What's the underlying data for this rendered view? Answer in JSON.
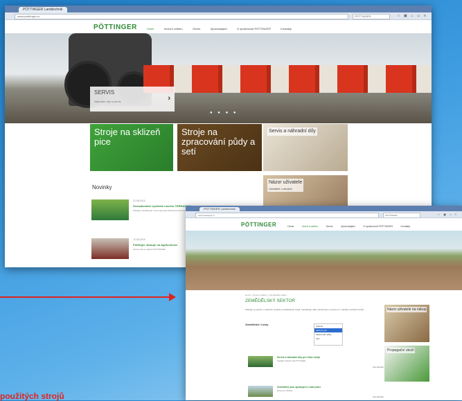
{
  "browser1": {
    "tab_title": "PÖTTINGER Landtechnik",
    "url": "www.poettinger.cz",
    "search": "PÖTTINGER"
  },
  "browser2": {
    "tab_title": "PÖTTINGER Landtechnik",
    "url": "www.poettinger.cz",
    "search": "PÖTTINGER"
  },
  "site": {
    "logo": "PÖTTINGER",
    "nav": [
      "Home",
      "Ihned k odběru",
      "Servis",
      "Zpravodajství",
      "O spolecnosti PÖTTINGER",
      "Kontakty"
    ]
  },
  "hero": {
    "title": "SERVIS",
    "subtitle": "Náhradní díly a servis"
  },
  "tiles": [
    {
      "label": "Stroje na sklizeň pice"
    },
    {
      "label": "Stroje na zpracování půdy a setí"
    },
    {
      "label": "Servis a náhradní díly"
    },
    {
      "label": "Názor uživatele",
      "text": "Uživatelé o strojích"
    }
  ],
  "news_heading": "Novinky",
  "news": [
    {
      "date": "21.08.2015",
      "title": "Sensationální výsledek nového TERRADISC",
      "body": "Pöttinger představuje novou generaci diskových bran na výstavě."
    },
    {
      "date": "12.08.2015",
      "title": "Pöttinger ukazuje na Agritechnice",
      "body": "Zveme vás na stánek PÖTTINGER."
    }
  ],
  "page2": {
    "breadcrumb": "Home > Ihned k odběru > Zemědělský sektor",
    "title": "ZEMĚDĚLSKÝ SEKTOR",
    "text": "Pöttinger je jedním z předních výrobců zemědělských strojů. Kontaktujte naše obchodníky a vyberte si z nabídky použitých strojů.",
    "form_label": "Zemědělství / Louky",
    "options": [
      "Vyberte",
      "Sklizeň pice",
      "Zpracování půdy",
      "Setí"
    ],
    "side_tiles": [
      {
        "label": "Názor uživatele na nákup"
      },
      {
        "label": "Propagační zboží"
      }
    ],
    "news": [
      {
        "title": "Servis a náhradní díly pro Vaše stroje",
        "text": "Originální náhradní díly PÖTTINGER.",
        "more": "Více informací"
      },
      {
        "title": "Zemědělci jsou spokojeni s naší prací",
        "text": "Reference uživatelů.",
        "more": "Více informací"
      }
    ]
  },
  "caption": "použitých strojů"
}
